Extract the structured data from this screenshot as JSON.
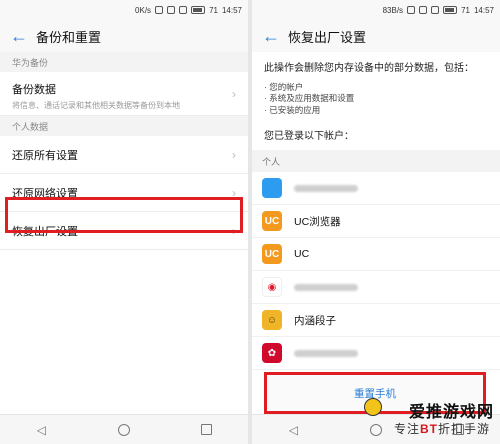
{
  "left": {
    "status": {
      "speed": "0K/s",
      "time": "14:57",
      "battery": "71"
    },
    "title": "备份和重置",
    "sections": [
      {
        "header": "华为备份",
        "items": [
          {
            "label": "备份数据",
            "sub": "将信息、通话记录和其他相关数据等备份到本地"
          }
        ]
      },
      {
        "header": "个人数据",
        "items": [
          {
            "label": "还原所有设置"
          },
          {
            "label": "还原网络设置"
          },
          {
            "label": "恢复出厂设置"
          }
        ]
      }
    ]
  },
  "right": {
    "status": {
      "speed": "83B/s",
      "time": "14:57",
      "battery": "71"
    },
    "title": "恢复出厂设置",
    "warning": "此操作会删除您内存设备中的部分数据，包括：",
    "bullets": [
      "· 您的帐户",
      "· 系统及应用数据和设置",
      "· 已安装的应用"
    ],
    "logged_in": "您已登录以下帐户：",
    "accounts_header": "个人",
    "accounts": [
      {
        "icon": "blue-square-icon",
        "name": "",
        "color": "#2d9bf0"
      },
      {
        "icon": "uc-browser-icon",
        "name": "UC浏览器",
        "color": "#f39a1e"
      },
      {
        "icon": "uc-icon",
        "name": "UC",
        "color": "#f39a1e"
      },
      {
        "icon": "weibo-icon",
        "name": "",
        "color": "#e6162d"
      },
      {
        "icon": "neihan-icon",
        "name": "内涵段子",
        "color": "#f0b429"
      },
      {
        "icon": "huawei-icon",
        "name": "",
        "color": "#cf0a2c"
      }
    ],
    "reset_button": "重置手机"
  },
  "watermark": {
    "line1": "爱推游戏网",
    "line2_prefix": "专注",
    "line2_bt": "BT",
    "line2_suffix": "折扣手游"
  }
}
